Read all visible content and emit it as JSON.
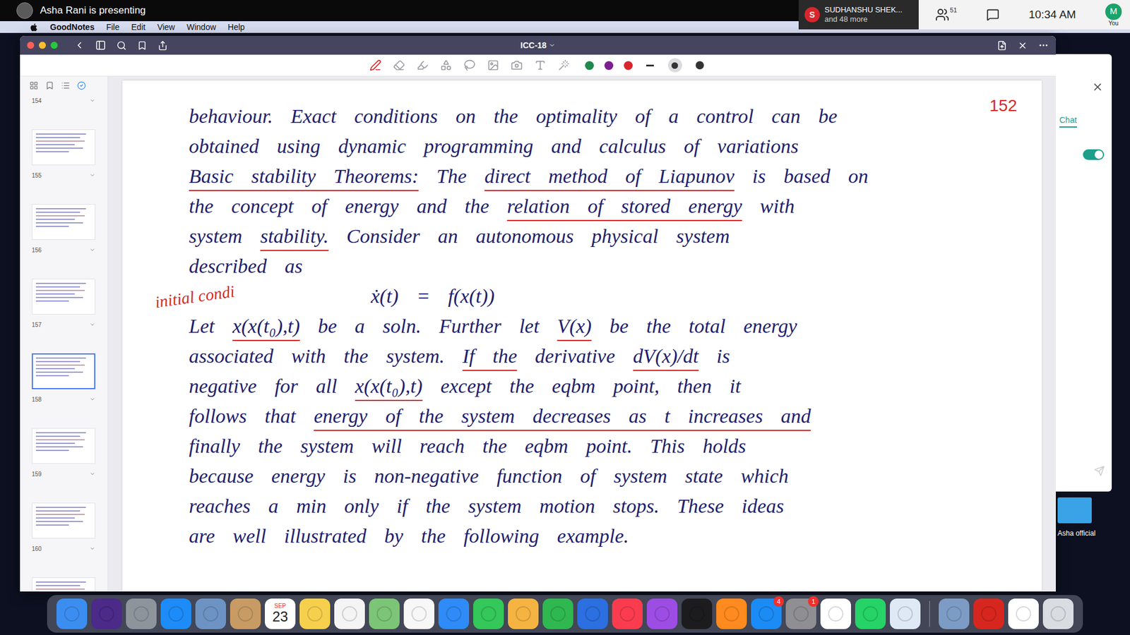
{
  "zoom": {
    "presenter_banner": "Asha Rani is presenting",
    "notification": {
      "initial": "S",
      "name": "SUDHANSHU SHEK...",
      "more": "and 48 more"
    },
    "participants": "51",
    "clock": "10:34 AM",
    "self": {
      "initial": "M",
      "label": "You"
    },
    "chat_panel": {
      "tab": "Chat",
      "toggle_on": true
    },
    "video_tile": {
      "label": "Asha official"
    }
  },
  "menu_bar": {
    "app": "GoodNotes",
    "items": [
      "File",
      "Edit",
      "View",
      "Window",
      "Help"
    ]
  },
  "window": {
    "title": "ICC-18"
  },
  "toolbar": {
    "tools": [
      {
        "kind": "pen",
        "selected": true
      },
      {
        "kind": "eraser",
        "selected": false
      },
      {
        "kind": "highlighter",
        "selected": false
      },
      {
        "kind": "shapes",
        "selected": false
      },
      {
        "kind": "lasso",
        "selected": false
      },
      {
        "kind": "image",
        "selected": false
      },
      {
        "kind": "camera",
        "selected": false
      },
      {
        "kind": "text",
        "selected": false
      },
      {
        "kind": "laser",
        "selected": false
      }
    ],
    "colors": [
      {
        "color": "#1f8a4c"
      },
      {
        "color": "#7b1f8f"
      },
      {
        "color": "#d9262c"
      }
    ],
    "sizes": [
      {
        "kind": "line",
        "selected": false
      },
      {
        "kind": "medium",
        "selected": true
      },
      {
        "kind": "large",
        "selected": false
      }
    ]
  },
  "sidebar": {
    "pages": [
      {
        "label": "154",
        "selected": false
      },
      {
        "label": "155",
        "selected": false
      },
      {
        "label": "156",
        "selected": false
      },
      {
        "label": "157",
        "selected": false
      },
      {
        "label": "158",
        "selected": true
      },
      {
        "label": "159",
        "selected": false
      },
      {
        "label": "160",
        "selected": false
      }
    ]
  },
  "page": {
    "number": "152",
    "annotation": "initial condi",
    "lines": [
      {
        "kind": "text",
        "segments": [
          {
            "text": "behaviour. Exact conditions on the optimality of a control can be",
            "underlined": false
          }
        ]
      },
      {
        "kind": "text",
        "segments": [
          {
            "text": "obtained using dynamic programming and calculus of variations",
            "underlined": false
          }
        ]
      },
      {
        "kind": "text",
        "segments": [
          {
            "text": "Basic stability Theorems:",
            "underlined": true
          },
          {
            "text": " The ",
            "underlined": false
          },
          {
            "text": "direct method of Liapunov",
            "underlined": true
          },
          {
            "text": " is based on",
            "underlined": false
          }
        ]
      },
      {
        "kind": "text",
        "segments": [
          {
            "text": "the concept of energy and the ",
            "underlined": false
          },
          {
            "text": "relation of stored energy",
            "underlined": true
          },
          {
            "text": " with",
            "underlined": false
          }
        ]
      },
      {
        "kind": "text",
        "segments": [
          {
            "text": "system ",
            "underlined": false
          },
          {
            "text": "stability.",
            "underlined": true
          },
          {
            "text": " Consider an autonomous physical system",
            "underlined": false
          }
        ]
      },
      {
        "kind": "text",
        "segments": [
          {
            "text": "described as",
            "underlined": false
          }
        ]
      },
      {
        "kind": "equation",
        "segments": [
          {
            "text": "ẋ(t) = f(x(t))",
            "underlined": false
          }
        ]
      },
      {
        "kind": "text",
        "segments": [
          {
            "text": "Let ",
            "underlined": false
          },
          {
            "text": "x(x(t₀),t)",
            "underlined": true
          },
          {
            "text": " be a soln. Further let ",
            "underlined": false
          },
          {
            "text": "V(x)",
            "underlined": true
          },
          {
            "text": " be the total energy",
            "underlined": false
          }
        ]
      },
      {
        "kind": "text",
        "segments": [
          {
            "text": "associated with the system. ",
            "underlined": false
          },
          {
            "text": "If the",
            "underlined": true
          },
          {
            "text": " derivative ",
            "underlined": false
          },
          {
            "text": "dV(x)/dt",
            "underlined": true
          },
          {
            "text": " is",
            "underlined": false
          }
        ]
      },
      {
        "kind": "text",
        "segments": [
          {
            "text": "negative for all ",
            "underlined": false
          },
          {
            "text": "x(x(t₀),t)",
            "underlined": true
          },
          {
            "text": " except the eqbm point, then it",
            "underlined": false
          }
        ]
      },
      {
        "kind": "text",
        "segments": [
          {
            "text": "follows that ",
            "underlined": false
          },
          {
            "text": "energy of the system decreases as t increases and",
            "underlined": true
          }
        ]
      },
      {
        "kind": "text",
        "segments": [
          {
            "text": "finally the system will reach the eqbm point. This holds",
            "underlined": false
          }
        ]
      },
      {
        "kind": "text",
        "segments": [
          {
            "text": "because energy is non-negative function of system state which",
            "underlined": false
          }
        ]
      },
      {
        "kind": "text",
        "segments": [
          {
            "text": "reaches a min only if the system motion stops. These ideas",
            "underlined": false
          }
        ]
      },
      {
        "kind": "text",
        "segments": [
          {
            "text": "are well illustrated by the following example.",
            "underlined": false
          }
        ]
      }
    ]
  },
  "dock": {
    "items": [
      {
        "kind": "app",
        "color": "#3b8ef0"
      },
      {
        "kind": "app",
        "color": "#4b2a8a"
      },
      {
        "kind": "app",
        "color": "#8e949c"
      },
      {
        "kind": "app",
        "color": "#1d8cf8"
      },
      {
        "kind": "app",
        "color": "#6d93c4"
      },
      {
        "kind": "app",
        "color": "#c89b64"
      },
      {
        "kind": "calendar",
        "color": "#ffffff",
        "month": "SEP",
        "day": "23"
      },
      {
        "kind": "app",
        "color": "#f6d04d"
      },
      {
        "kind": "app",
        "color": "#f4f4f4"
      },
      {
        "kind": "app",
        "color": "#7cc576"
      },
      {
        "kind": "app",
        "color": "#f7f7f7"
      },
      {
        "kind": "app",
        "color": "#2f8bf7"
      },
      {
        "kind": "app",
        "color": "#34c759"
      },
      {
        "kind": "app",
        "color": "#f5b342"
      },
      {
        "kind": "app",
        "color": "#2fb84f"
      },
      {
        "kind": "app",
        "color": "#2b6fe0"
      },
      {
        "kind": "app",
        "color": "#fb3c4f"
      },
      {
        "kind": "app",
        "color": "#9d4de3"
      },
      {
        "kind": "app",
        "color": "#1c1c1e"
      },
      {
        "kind": "app",
        "color": "#ff8a1f"
      },
      {
        "kind": "app",
        "color": "#1b8bf5",
        "badge": "4"
      },
      {
        "kind": "app",
        "color": "#8e8e93",
        "badge": "1"
      },
      {
        "kind": "app",
        "color": "#ffffff"
      },
      {
        "kind": "app",
        "color": "#25d366"
      },
      {
        "kind": "app",
        "color": "#dfe8f5"
      },
      {
        "kind": "separator"
      },
      {
        "kind": "app",
        "color": "#7c9cc6"
      },
      {
        "kind": "app",
        "color": "#d7261e"
      },
      {
        "kind": "app",
        "color": "#ffffff"
      },
      {
        "kind": "app",
        "color": "#d9dde2"
      }
    ]
  }
}
